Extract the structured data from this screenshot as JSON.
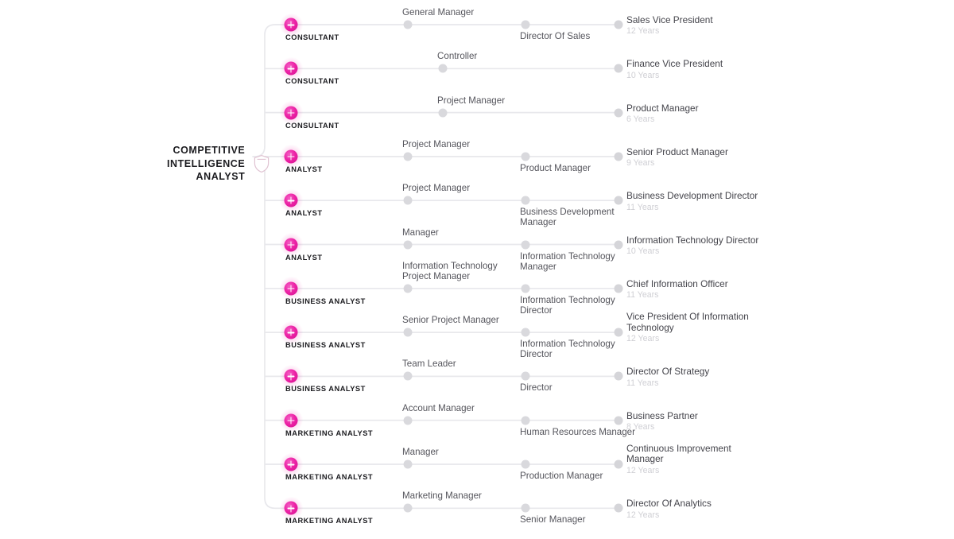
{
  "meta": {
    "background_color": "#ffffff",
    "accent_color": "#ec21a5",
    "line_color": "#e8e8ec",
    "dot_color": "#d9d9dd",
    "years_color": "#cfcfd4"
  },
  "root": {
    "label": "COMPETITIVE\nINTELLIGENCE\nANALYST",
    "icon": "shield-icon"
  },
  "rows": [
    {
      "start_label": "CONSULTANT",
      "steps": [
        {
          "label": "General Manager",
          "position": "above"
        },
        {
          "label": "Director Of Sales",
          "position": "below"
        }
      ],
      "end_title": "Sales Vice President",
      "end_years": "12 Years"
    },
    {
      "start_label": "CONSULTANT",
      "steps": [
        {
          "label": "Controller",
          "position": "above"
        }
      ],
      "end_title": "Finance Vice President",
      "end_years": "10 Years"
    },
    {
      "start_label": "CONSULTANT",
      "steps": [
        {
          "label": "Project Manager",
          "position": "above"
        }
      ],
      "end_title": "Product Manager",
      "end_years": "6 Years"
    },
    {
      "start_label": "ANALYST",
      "steps": [
        {
          "label": "Project Manager",
          "position": "above"
        },
        {
          "label": "Product Manager",
          "position": "below"
        }
      ],
      "end_title": "Senior Product Manager",
      "end_years": "9 Years"
    },
    {
      "start_label": "ANALYST",
      "steps": [
        {
          "label": "Project Manager",
          "position": "above"
        },
        {
          "label": "Business Development Manager",
          "position": "below"
        }
      ],
      "end_title": "Business Development Director",
      "end_years": "11 Years"
    },
    {
      "start_label": "ANALYST",
      "steps": [
        {
          "label": "Manager",
          "position": "above"
        },
        {
          "label": "Information Technology Manager",
          "position": "below"
        }
      ],
      "end_title": "Information Technology Director",
      "end_years": "10 Years"
    },
    {
      "start_label": "BUSINESS ANALYST",
      "steps": [
        {
          "label": "Information Technology Project Manager",
          "position": "above"
        },
        {
          "label": "Information Technology Director",
          "position": "below"
        }
      ],
      "end_title": "Chief Information Officer",
      "end_years": "11 Years"
    },
    {
      "start_label": "BUSINESS ANALYST",
      "steps": [
        {
          "label": "Senior Project Manager",
          "position": "above"
        },
        {
          "label": "Information Technology Director",
          "position": "below"
        }
      ],
      "end_title": "Vice President Of Information Technology",
      "end_years": "12 Years"
    },
    {
      "start_label": "BUSINESS ANALYST",
      "steps": [
        {
          "label": "Team Leader",
          "position": "above"
        },
        {
          "label": "Director",
          "position": "below"
        }
      ],
      "end_title": "Director Of Strategy",
      "end_years": "11 Years"
    },
    {
      "start_label": "MARKETING ANALYST",
      "steps": [
        {
          "label": "Account Manager",
          "position": "above"
        },
        {
          "label": "Human Resources Manager",
          "position": "below"
        }
      ],
      "end_title": "Business Partner",
      "end_years": "8 Years"
    },
    {
      "start_label": "MARKETING ANALYST",
      "steps": [
        {
          "label": "Manager",
          "position": "above"
        },
        {
          "label": "Production Manager",
          "position": "below"
        }
      ],
      "end_title": "Continuous Improvement Manager",
      "end_years": "12 Years"
    },
    {
      "start_label": "MARKETING ANALYST",
      "steps": [
        {
          "label": "Marketing Manager",
          "position": "above"
        },
        {
          "label": "Senior Manager",
          "position": "below"
        }
      ],
      "end_title": "Director Of Analytics",
      "end_years": "12 Years"
    }
  ]
}
